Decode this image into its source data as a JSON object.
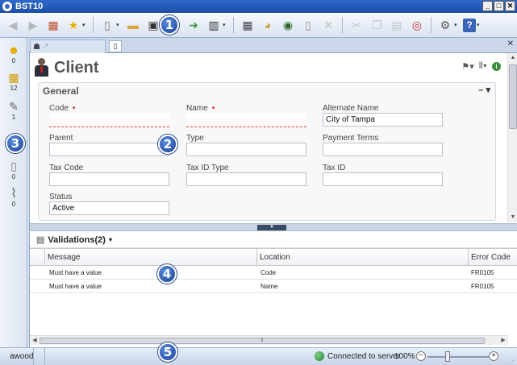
{
  "app": {
    "title": "BST10"
  },
  "window_controls": {
    "minimize": "_",
    "maximize": "□",
    "close": "✕"
  },
  "toolbar": {
    "items": [
      {
        "icon": "back-arrow-icon",
        "glyph": "◀"
      },
      {
        "icon": "forward-arrow-icon",
        "glyph": "▶"
      },
      {
        "icon": "calendar-icon",
        "glyph": "▦"
      },
      {
        "icon": "favorites-star-icon",
        "glyph": "★"
      },
      {
        "icon": "new-document-icon",
        "glyph": "▯"
      },
      {
        "icon": "open-folder-icon",
        "glyph": "▬"
      },
      {
        "icon": "save-icon",
        "glyph": "▣"
      },
      {
        "icon": "print-preview-icon",
        "glyph": "▤"
      },
      {
        "icon": "go-arrow-icon",
        "glyph": "➜"
      },
      {
        "icon": "clapperboard-icon",
        "glyph": "▥"
      },
      {
        "icon": "form-view-icon",
        "glyph": "▦"
      },
      {
        "icon": "chart-icon",
        "glyph": "◕"
      },
      {
        "icon": "compass-icon",
        "glyph": "◉"
      },
      {
        "icon": "clipboard-icon",
        "glyph": "▯"
      },
      {
        "icon": "delete-x-icon",
        "glyph": "✕"
      },
      {
        "icon": "cut-icon",
        "glyph": "✂"
      },
      {
        "icon": "copy-icon",
        "glyph": "❐"
      },
      {
        "icon": "paste-icon",
        "glyph": "▤"
      },
      {
        "icon": "attach-icon",
        "glyph": "◎"
      },
      {
        "icon": "refresh-icon",
        "glyph": "↻"
      },
      {
        "icon": "settings-gear-icon",
        "glyph": "⚙"
      },
      {
        "icon": "help-icon",
        "glyph": "?"
      }
    ]
  },
  "callouts": [
    "1",
    "2",
    "3",
    "4",
    "5"
  ],
  "sidebar": {
    "items": [
      {
        "icon": "contacts-icon",
        "glyph": "☻",
        "count": "0"
      },
      {
        "icon": "calendar-icon",
        "glyph": "▦",
        "count": "12"
      },
      {
        "icon": "notes-icon",
        "glyph": "✎",
        "count": "1"
      },
      {
        "icon": "document-icon",
        "glyph": "▯",
        "count": "0"
      },
      {
        "icon": "attachment-icon",
        "glyph": "⌇",
        "count": "0"
      }
    ]
  },
  "tabs": {
    "doc_label": "-*",
    "close": "✕"
  },
  "client": {
    "title": "Client",
    "section_title": "General",
    "section_toggle": "– ▾",
    "fields": {
      "code": {
        "label": "Code",
        "value": ""
      },
      "name": {
        "label": "Name",
        "value": ""
      },
      "alternate_name": {
        "label": "Alternate Name",
        "value": "City of Tampa"
      },
      "parent": {
        "label": "Parent",
        "value": ""
      },
      "type": {
        "label": "Type",
        "value": ""
      },
      "payment_terms": {
        "label": "Payment Terms",
        "value": ""
      },
      "tax_code": {
        "label": "Tax Code",
        "value": ""
      },
      "tax_id_type": {
        "label": "Tax ID Type",
        "value": ""
      },
      "tax_id": {
        "label": "Tax ID",
        "value": ""
      },
      "status": {
        "label": "Status",
        "value": "Active"
      }
    },
    "required_marker": "•"
  },
  "validations": {
    "title": "Validations(2)",
    "columns": [
      "Message",
      "Location",
      "Error Code"
    ],
    "rows": [
      {
        "message": "Must have a value",
        "location": "Code",
        "error_code": "FR0105"
      },
      {
        "message": "Must have a value",
        "location": "Name",
        "error_code": "FR0105"
      }
    ]
  },
  "status": {
    "user": "awood",
    "connection": "Connected to server",
    "zoom": "100%"
  }
}
